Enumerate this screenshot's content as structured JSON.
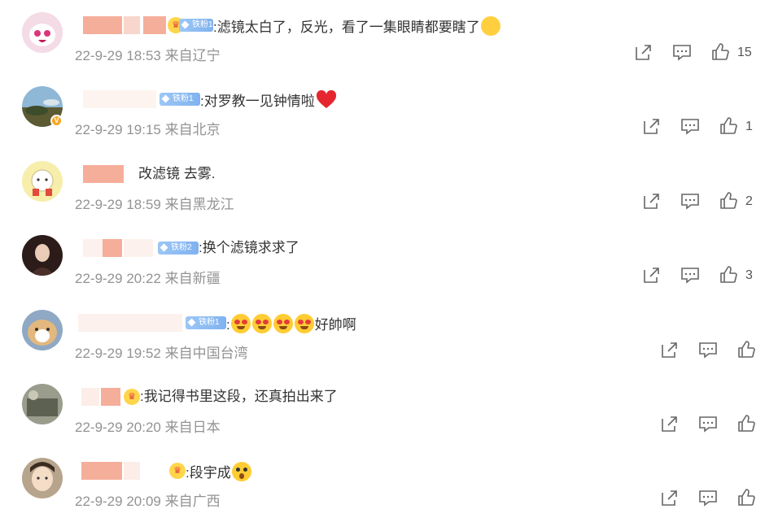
{
  "comments": [
    {
      "text": ":滤镜太白了，反光，看了一集眼睛都要瞎了",
      "fan": "铁粉1",
      "time": "22-9-29 18:53",
      "location": "来自辽宁",
      "likes": "15",
      "avatar_color": "#f2d4df"
    },
    {
      "text": ":对罗教一见钟情啦",
      "fan": "铁粉1",
      "time": "22-9-29 19:15",
      "location": "来自北京",
      "likes": "1",
      "avatar_color": "#5b7a8c"
    },
    {
      "text": "改滤镜 去雾.",
      "fan": "",
      "time": "22-9-29 18:59",
      "location": "来自黑龙江",
      "likes": "2",
      "avatar_color": "#f3e9a8"
    },
    {
      "text": ":换个滤镜求求了",
      "fan": "铁粉2",
      "time": "22-9-29 20:22",
      "location": "来自新疆",
      "likes": "3",
      "avatar_color": "#3a2a28"
    },
    {
      "text": "好帥啊",
      "fan": "铁粉1",
      "time": "22-9-29 19:52",
      "location": "来自中国台湾",
      "likes": "",
      "avatar_color": "#d8b07a"
    },
    {
      "text": ":我记得书里这段，还真拍出来了",
      "fan": "",
      "time": "22-9-29 20:20",
      "location": "来自日本",
      "likes": "",
      "avatar_color": "#7a7f70"
    },
    {
      "text": ":段宇成",
      "fan": "",
      "time": "22-9-29 20:09",
      "location": "来自广西",
      "likes": "",
      "avatar_color": "#e9d2b8"
    }
  ],
  "icons": {
    "share": "share-icon",
    "reply": "comment-icon",
    "like": "thumbs-up-icon"
  }
}
